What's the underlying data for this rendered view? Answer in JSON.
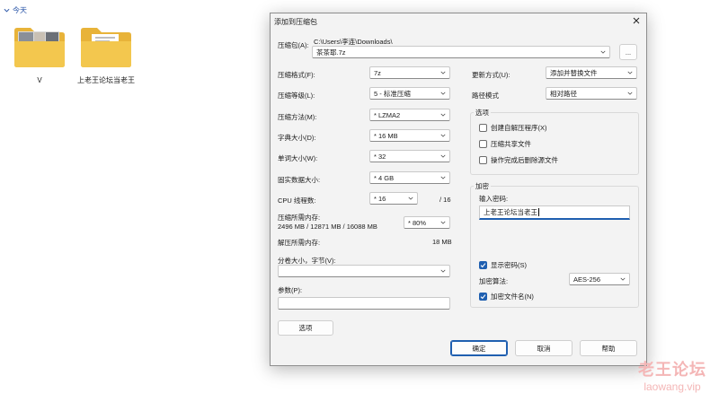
{
  "explorer": {
    "group_label": "今天",
    "folders": [
      {
        "name": "V"
      },
      {
        "name": "上老王论坛当老王"
      }
    ]
  },
  "dialog": {
    "title": "添加到压缩包",
    "archive_label": "压缩包(A):",
    "archive_dir": "C:\\Users\\李连\\Downloads\\",
    "archive_name": "茶茶耶.7z",
    "browse_label": "...",
    "left": {
      "format_label": "压缩格式(F):",
      "format_value": "7z",
      "level_label": "压缩等级(L):",
      "level_value": "5 - 标准压缩",
      "method_label": "压缩方法(M):",
      "method_value": "* LZMA2",
      "dict_label": "字典大小(D):",
      "dict_value": "* 16 MB",
      "word_label": "单词大小(W):",
      "word_value": "* 32",
      "solid_label": "固实数据大小:",
      "solid_value": "* 4 GB",
      "threads_label": "CPU 线程数:",
      "threads_value": "* 16",
      "threads_max": "/ 16",
      "mem_label": "压缩所需内存:",
      "mem_detail": "2496 MB / 12871 MB / 16088 MB",
      "mem_percent": "* 80%",
      "decomp_label": "解压所需内存:",
      "decomp_value": "18 MB",
      "split_label": "分卷大小，字节(V):",
      "split_value": "",
      "params_label": "参数(P):",
      "params_value": "",
      "options_button": "选项"
    },
    "right": {
      "update_label": "更新方式(U):",
      "update_value": "添加并替换文件",
      "path_label": "路径模式",
      "path_value": "相对路径",
      "options_group": "选项",
      "opt_sfx": "创建自解压程序(X)",
      "opt_shared": "压缩共享文件",
      "opt_delete": "操作完成后删除源文件",
      "encrypt_group": "加密",
      "pwd_label": "输入密码:",
      "pwd_value": "上老王论坛当老王",
      "show_pwd": "显示密码(S)",
      "enc_method_label": "加密算法:",
      "enc_method_value": "AES-256",
      "enc_names": "加密文件名(N)"
    },
    "buttons": {
      "ok": "确定",
      "cancel": "取消",
      "help": "帮助"
    }
  },
  "watermark": {
    "big": "老王论坛",
    "small": "laowang.vip"
  },
  "colors": {
    "accent": "#1f5fb0",
    "folder": "#f0c14b",
    "group_header": "#2a55a8"
  }
}
